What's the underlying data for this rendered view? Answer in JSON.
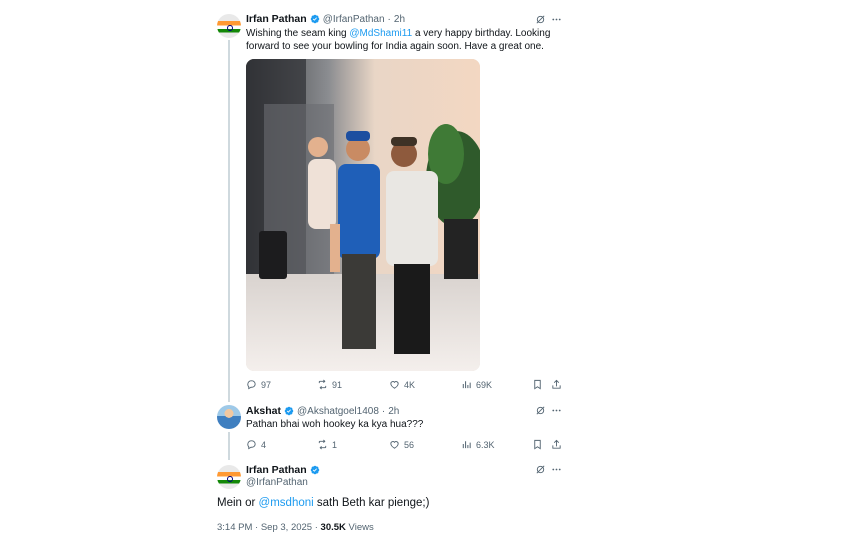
{
  "tweet1": {
    "author_name": "Irfan Pathan",
    "author_handle": "@IrfanPathan",
    "separator": "·",
    "time": "2h",
    "text_before": "Wishing the seam king ",
    "mention": "@MdShami11",
    "text_after": " a very happy birthday. Looking forward to see your bowling for India again soon. Have a great one.",
    "replies": "97",
    "reposts": "91",
    "likes": "4K",
    "views": "69K"
  },
  "tweet2": {
    "author_name": "Akshat",
    "author_handle": "@Akshatgoel1408",
    "separator": "·",
    "time": "2h",
    "text": "Pathan bhai woh hookey ka kya hua???",
    "replies": "4",
    "reposts": "1",
    "likes": "56",
    "views": "6.3K"
  },
  "main_tweet": {
    "author_name": "Irfan Pathan",
    "author_handle": "@IrfanPathan",
    "text_before": "Mein or ",
    "mention": "@msdhoni",
    "text_after": " sath Beth kar pienge;)",
    "time": "3:14 PM",
    "date": "Sep 3, 2025",
    "separator": "·",
    "views_count": "30.5K",
    "views_label": "Views"
  },
  "colors": {
    "accent": "#1d9bf0",
    "secondary_text": "#536471",
    "thread_line": "#cfd9de"
  },
  "icons": [
    "grok-icon",
    "more-icon",
    "verified-icon",
    "reply-icon",
    "repost-icon",
    "like-icon",
    "views-icon",
    "bookmark-icon",
    "share-icon"
  ]
}
